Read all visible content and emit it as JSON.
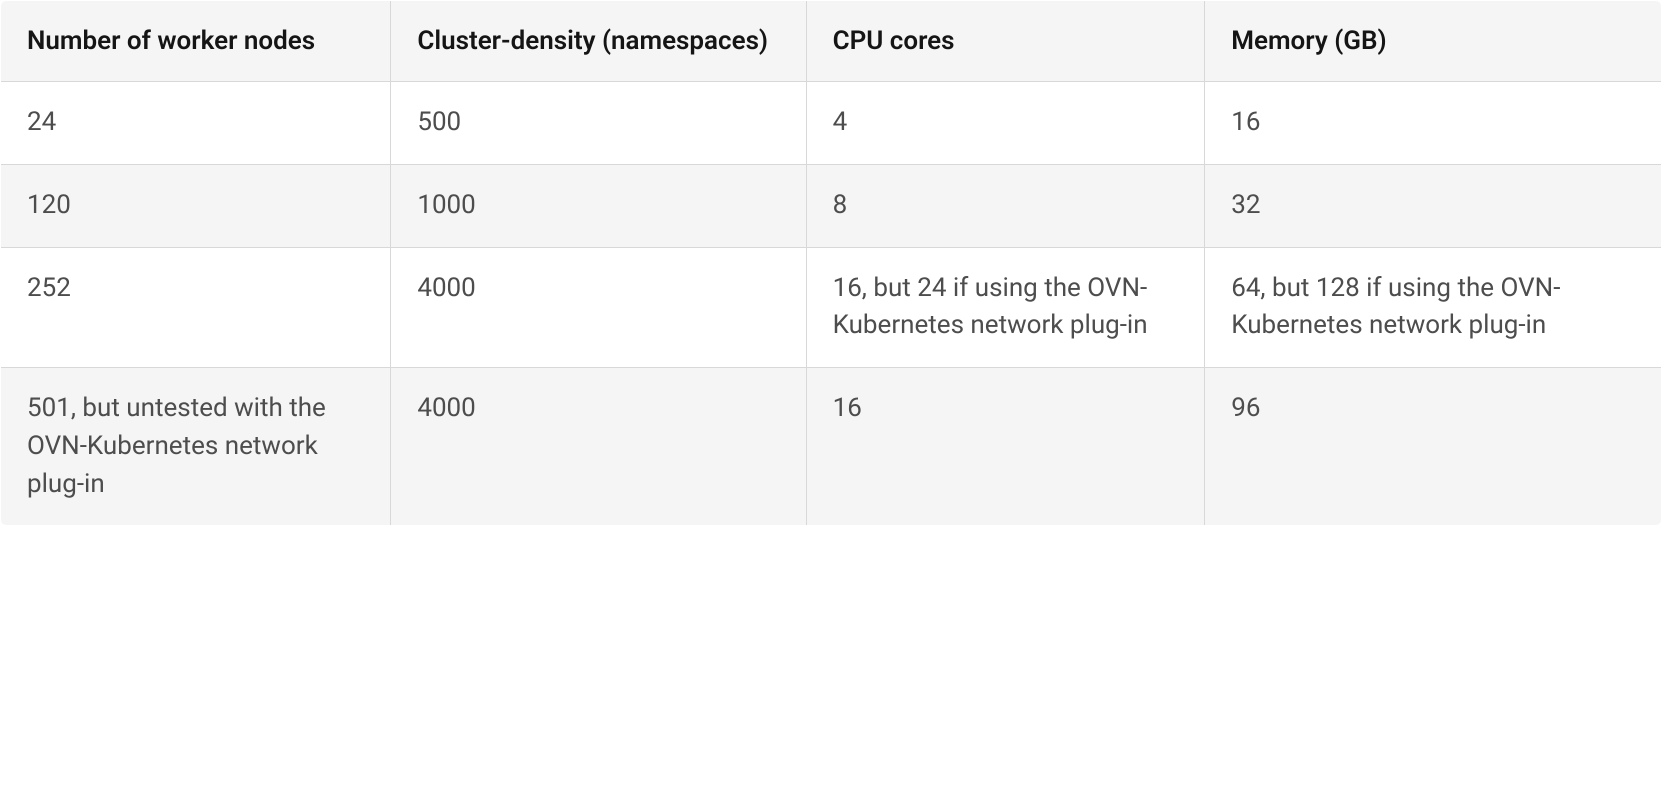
{
  "chart_data": {
    "type": "table",
    "headers": [
      "Number of worker nodes",
      "Cluster-density (namespaces)",
      "CPU cores",
      "Memory (GB)"
    ],
    "rows": [
      {
        "worker_nodes": "24",
        "cluster_density": "500",
        "cpu_cores": "4",
        "memory_gb": "16"
      },
      {
        "worker_nodes": "120",
        "cluster_density": "1000",
        "cpu_cores": "8",
        "memory_gb": "32"
      },
      {
        "worker_nodes": "252",
        "cluster_density": "4000",
        "cpu_cores": "16, but 24 if using the OVN-Kubernetes network plug-in",
        "memory_gb": "64, but 128 if using the OVN-Kubernetes network plug-in"
      },
      {
        "worker_nodes": "501, but untested with the OVN-Kubernetes network plug-in",
        "cluster_density": "4000",
        "cpu_cores": "16",
        "memory_gb": "96"
      }
    ]
  }
}
